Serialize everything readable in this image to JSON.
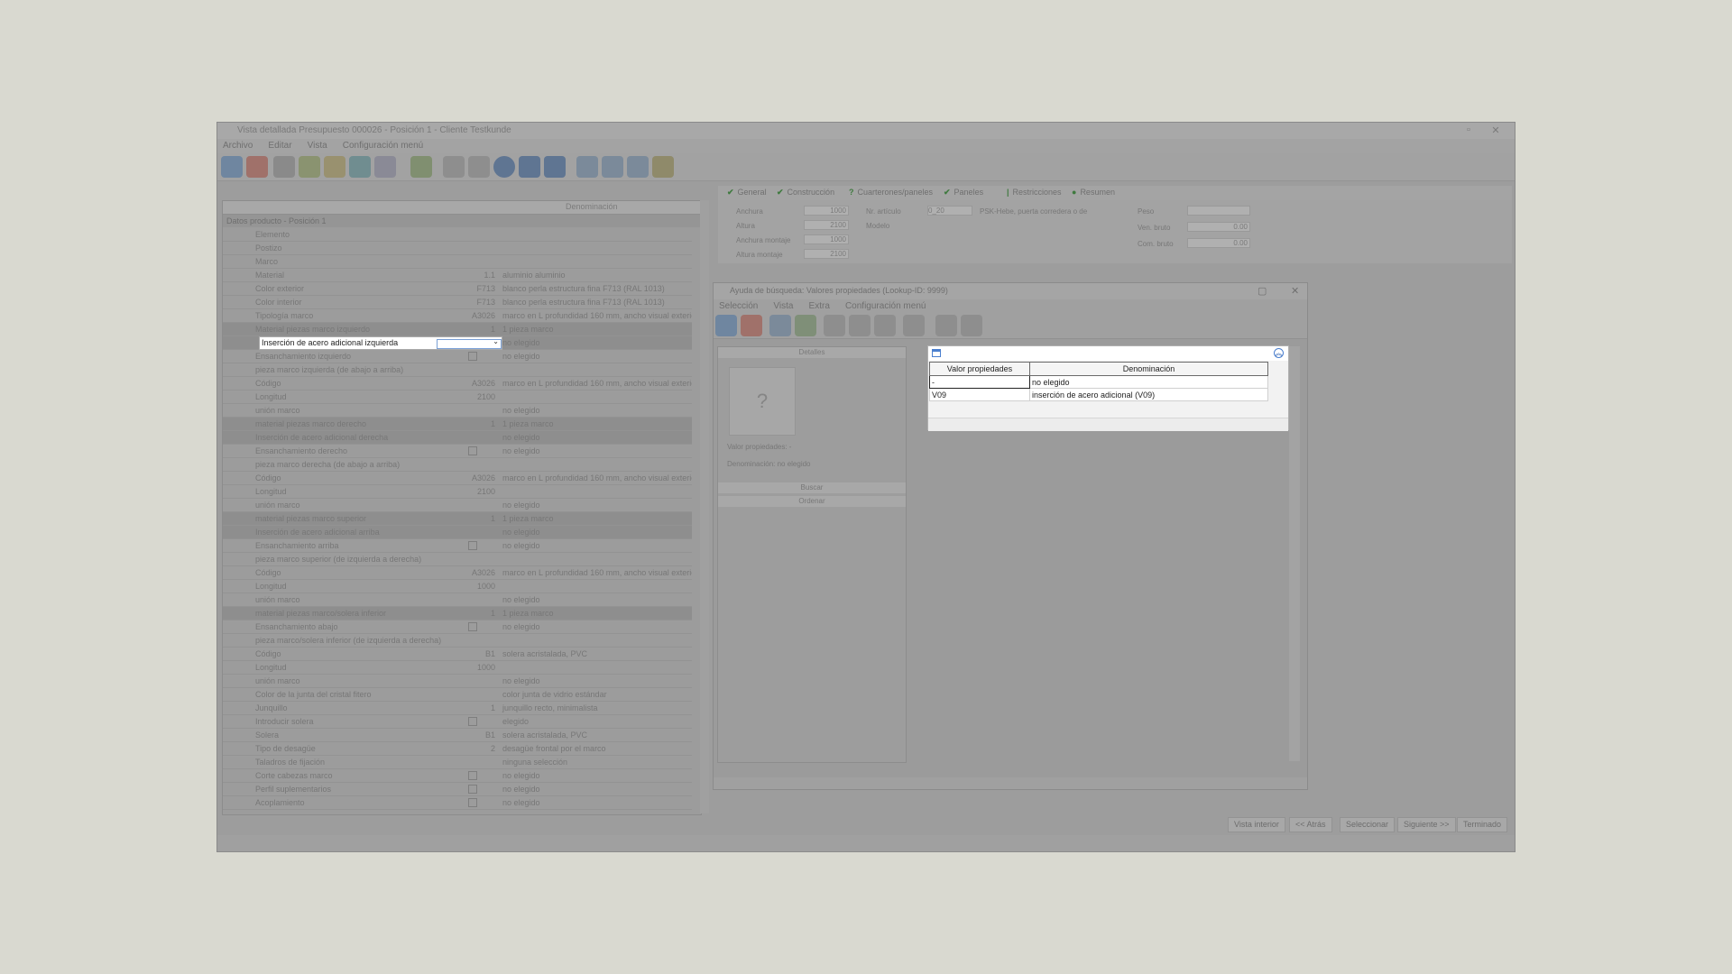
{
  "main_window": {
    "title": "Vista detallada Presupuesto 000026 - Posición 1 - Cliente Testkunde",
    "menu": [
      "Archivo",
      "Editar",
      "Vista",
      "Configuración menú"
    ]
  },
  "property_grid": {
    "header_denominacion": "Denominación",
    "section": "Datos producto - Posición 1",
    "rows": [
      {
        "label": "Elemento",
        "value": "",
        "desc": "",
        "dark": false
      },
      {
        "label": "Postizo",
        "value": "",
        "desc": "",
        "dark": false
      },
      {
        "label": "Marco",
        "value": "",
        "desc": "",
        "dark": false
      },
      {
        "label": "Material",
        "value": "1.1",
        "desc": "aluminio aluminio",
        "dark": false
      },
      {
        "label": "Color exterior",
        "value": "F713",
        "desc": "blanco perla estructura fina F713 (RAL 1013)",
        "dark": false
      },
      {
        "label": "Color interior",
        "value": "F713",
        "desc": "blanco perla estructura fina F713 (RAL 1013)",
        "dark": false
      },
      {
        "label": "Tipología marco",
        "value": "A3026",
        "desc": "marco en L profundidad 160 mm, ancho visual exterior",
        "dark": false
      },
      {
        "label": "Material piezas marco izquierdo",
        "value": "1",
        "desc": "1 pieza marco",
        "dark": true
      },
      {
        "label": "",
        "value": "",
        "desc": "no elegido",
        "dark": true
      },
      {
        "label": "Ensanchamiento izquierdo",
        "value": "",
        "desc": "no elegido",
        "dark": false,
        "check": true
      },
      {
        "label": "pieza marco izquierda (de abajo a arriba)",
        "value": "",
        "desc": "",
        "dark": false
      },
      {
        "label": "Código",
        "value": "A3026",
        "desc": "marco en L profundidad 160 mm, ancho visual exterior",
        "dark": false
      },
      {
        "label": "Longitud",
        "value": "2100",
        "desc": "",
        "dark": false
      },
      {
        "label": "unión marco",
        "value": "",
        "desc": "no elegido",
        "dark": false
      },
      {
        "label": "material piezas marco derecho",
        "value": "1",
        "desc": "1 pieza marco",
        "dark": true
      },
      {
        "label": "Inserción de acero adicional derecha",
        "value": "",
        "desc": "no elegido",
        "dark": true
      },
      {
        "label": "Ensanchamiento derecho",
        "value": "",
        "desc": "no elegido",
        "dark": false,
        "check": true
      },
      {
        "label": "pieza marco derecha (de abajo a arriba)",
        "value": "",
        "desc": "",
        "dark": false
      },
      {
        "label": "Código",
        "value": "A3026",
        "desc": "marco en L profundidad 160 mm, ancho visual exterior",
        "dark": false
      },
      {
        "label": "Longitud",
        "value": "2100",
        "desc": "",
        "dark": false
      },
      {
        "label": "unión marco",
        "value": "",
        "desc": "no elegido",
        "dark": false
      },
      {
        "label": "material piezas marco superior",
        "value": "1",
        "desc": "1 pieza marco",
        "dark": true
      },
      {
        "label": "Inserción de acero adicional arriba",
        "value": "",
        "desc": "no elegido",
        "dark": true
      },
      {
        "label": "Ensanchamiento arriba",
        "value": "",
        "desc": "no elegido",
        "dark": false,
        "check": true
      },
      {
        "label": "pieza marco superior (de izquierda a derecha)",
        "value": "",
        "desc": "",
        "dark": false
      },
      {
        "label": "Código",
        "value": "A3026",
        "desc": "marco en L profundidad 160 mm, ancho visual exterior",
        "dark": false
      },
      {
        "label": "Longitud",
        "value": "1000",
        "desc": "",
        "dark": false
      },
      {
        "label": "unión marco",
        "value": "",
        "desc": "no elegido",
        "dark": false
      },
      {
        "label": "material piezas marco/solera inferior",
        "value": "1",
        "desc": "1 pieza marco",
        "dark": true
      },
      {
        "label": "Ensanchamiento abajo",
        "value": "",
        "desc": "no elegido",
        "dark": false,
        "check": true
      },
      {
        "label": "pieza marco/solera inferior (de izquierda a derecha)",
        "value": "",
        "desc": "",
        "dark": false
      },
      {
        "label": "Código",
        "value": "B1",
        "desc": "solera acristalada, PVC",
        "dark": false
      },
      {
        "label": "Longitud",
        "value": "1000",
        "desc": "",
        "dark": false
      },
      {
        "label": "unión marco",
        "value": "",
        "desc": "no elegido",
        "dark": false
      },
      {
        "label": "Color de la junta del cristal fitero",
        "value": "",
        "desc": "color junta de vidrio estándar",
        "dark": false
      },
      {
        "label": "Junquillo",
        "value": "1",
        "desc": "junquillo recto, minimalista",
        "dark": false
      },
      {
        "label": "Introducir solera",
        "value": "",
        "desc": "elegido",
        "dark": false,
        "check": true
      },
      {
        "label": "Solera",
        "value": "B1",
        "desc": "solera acristalada, PVC",
        "dark": false
      },
      {
        "label": "Tipo de desagüe",
        "value": "2",
        "desc": "desagüe frontal por el marco",
        "dark": false
      },
      {
        "label": "Taladros de fijación",
        "value": "",
        "desc": "ninguna selección",
        "dark": false
      },
      {
        "label": "Corte cabezas marco",
        "value": "",
        "desc": "no elegido",
        "dark": false,
        "check": true
      },
      {
        "label": "Perfil suplementarios",
        "value": "",
        "desc": "no elegido",
        "dark": false,
        "check": true
      },
      {
        "label": "Acoplamiento",
        "value": "",
        "desc": "no elegido",
        "dark": false,
        "check": true
      }
    ]
  },
  "edit_row": {
    "label": "Inserción de acero adicional izquierda",
    "combo_value": "",
    "combo_arrow": "⌄"
  },
  "tabs": [
    "General",
    "Construcción",
    "Cuarterones/paneles",
    "Paneles",
    "Restricciones",
    "Resumen"
  ],
  "general": {
    "anchura_label": "Anchura",
    "altura_label": "Altura",
    "anchura_montaje_label": "Anchura montaje",
    "altura_montaje_label": "Altura montaje",
    "articulo_label": "Nr. artículo",
    "modelo_label": "Modelo",
    "peso_label": "Peso",
    "ven_bruto_label": "Ven. bruto",
    "com_bruto_label": "Com. bruto",
    "anchura": "1000",
    "altura": "2100",
    "anchura_montaje": "1000",
    "altura_montaje": "2100",
    "articulo": "0_20",
    "articulo_desc": "PSK-Hebe, puerta corredera o de",
    "ven_bruto": "0.00",
    "com_bruto": "0.00"
  },
  "bottom_buttons": [
    "Vista interior",
    "<< Atrás",
    "Seleccionar",
    "Siguiente >>",
    "Terminado"
  ],
  "lookup": {
    "title": "Ayuda de búsqueda: Valores propiedades (Lookup-ID: 9999)",
    "menu": [
      "Selección",
      "Vista",
      "Extra",
      "Configuración menú"
    ],
    "details_label": "Detalles",
    "placeholder_glyph": "?",
    "valor_label": "Valor propiedades: -",
    "denominacion_label": "Denominación: no elegido",
    "buscar_label": "Buscar",
    "ordenar_label": "Ordenar"
  },
  "results": {
    "columns": [
      "Valor propiedades",
      "Denominación"
    ],
    "rows": [
      {
        "value": "-",
        "desc": "no elegido"
      },
      {
        "value": "V09",
        "desc": "inserción de acero adicional (V09)"
      }
    ],
    "collapse_glyph": "︽"
  },
  "colors": {
    "accent": "#4a7fcf",
    "drawing_glass": "#3f8f8a"
  }
}
